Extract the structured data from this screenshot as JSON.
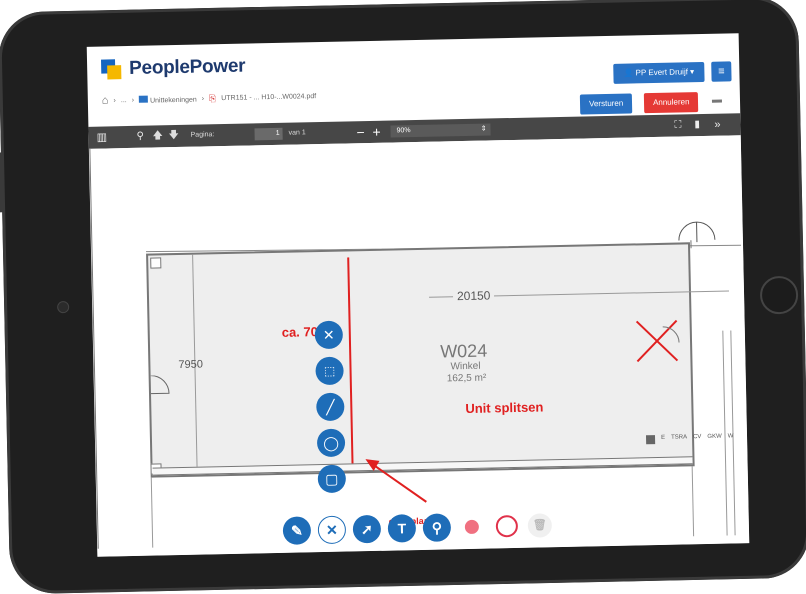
{
  "header": {
    "logo_text": "PeoplePower",
    "user_label": "PP Evert Druijf",
    "menu_icon": "hamburger-icon"
  },
  "breadcrumb": {
    "home_icon": "home-icon",
    "sep1": "›",
    "ellipsis": "...",
    "sep2": "›",
    "folder": "Unittekeningen",
    "sep3": "›",
    "file": "UTR151 - ... H10-...W0024.pdf"
  },
  "actions": {
    "send_label": "Versturen",
    "cancel_label": "Annuleren",
    "chat_icon": "comment-icon"
  },
  "viewer_toolbar": {
    "page_label": "Pagina:",
    "page_value": "1",
    "page_total": "van 1",
    "zoom_value": "90%",
    "minus": "−",
    "plus": "+"
  },
  "drawing": {
    "dim_width": "20150",
    "dim_height": "7950",
    "room_code": "W024",
    "room_type": "Winkel",
    "room_area": "162,5 m²",
    "legend": [
      "E",
      "TSRA",
      "CV",
      "GKW",
      "W"
    ],
    "annotation_area": "ca. 70m2",
    "annotation_split": "Unit splitsen",
    "annotation_door": "deur plaatsen"
  },
  "colors": {
    "primary": "#1e6db8",
    "danger": "#e53935",
    "annotation": "#e02020",
    "toolbar": "#474747",
    "logo_blue": "#1565c0",
    "logo_yellow": "#f5b800"
  }
}
